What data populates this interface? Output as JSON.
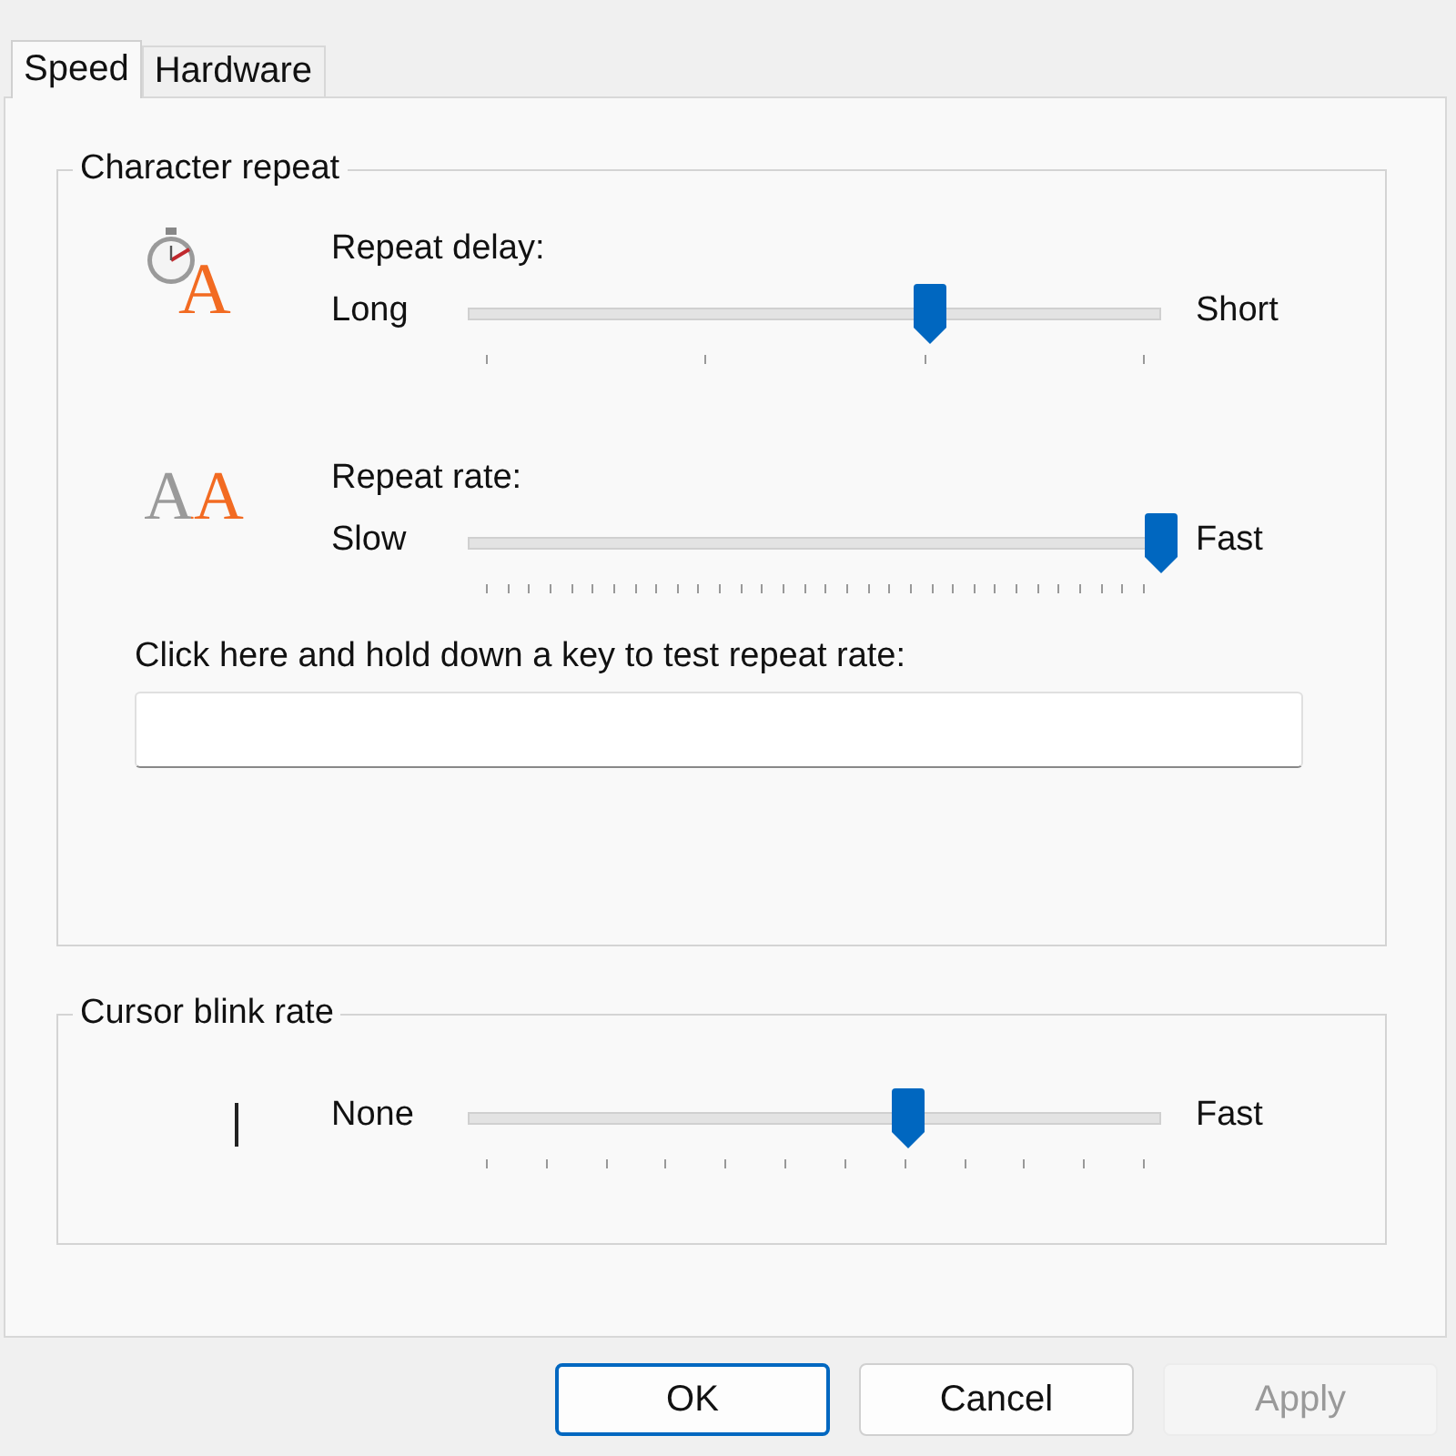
{
  "tabs": [
    {
      "label": "Speed",
      "selected": true
    },
    {
      "label": "Hardware",
      "selected": false
    }
  ],
  "character_repeat": {
    "title": "Character repeat",
    "sliders": [
      {
        "kind": "delay",
        "icon_text": "A",
        "label": "Repeat delay:",
        "min_label": "Long",
        "max_label": "Short",
        "level": 0.667
      },
      {
        "kind": "rate",
        "icon_text": "AA",
        "label": "Repeat rate:",
        "min_label": "Slow",
        "max_label": "Fast",
        "level": 1
      }
    ],
    "test": {
      "label": "Click here and hold down a key to test repeat rate:"
    }
  },
  "cursor_blink": {
    "title": "Cursor blink rate",
    "min_label": "None",
    "max_label": "Fast",
    "level": 0.636
  },
  "buttons": [
    {
      "label": "OK",
      "default": true,
      "disabled": false
    },
    {
      "label": "Cancel",
      "default": false,
      "disabled": false
    },
    {
      "label": "Apply",
      "default": false,
      "disabled": true
    }
  ]
}
